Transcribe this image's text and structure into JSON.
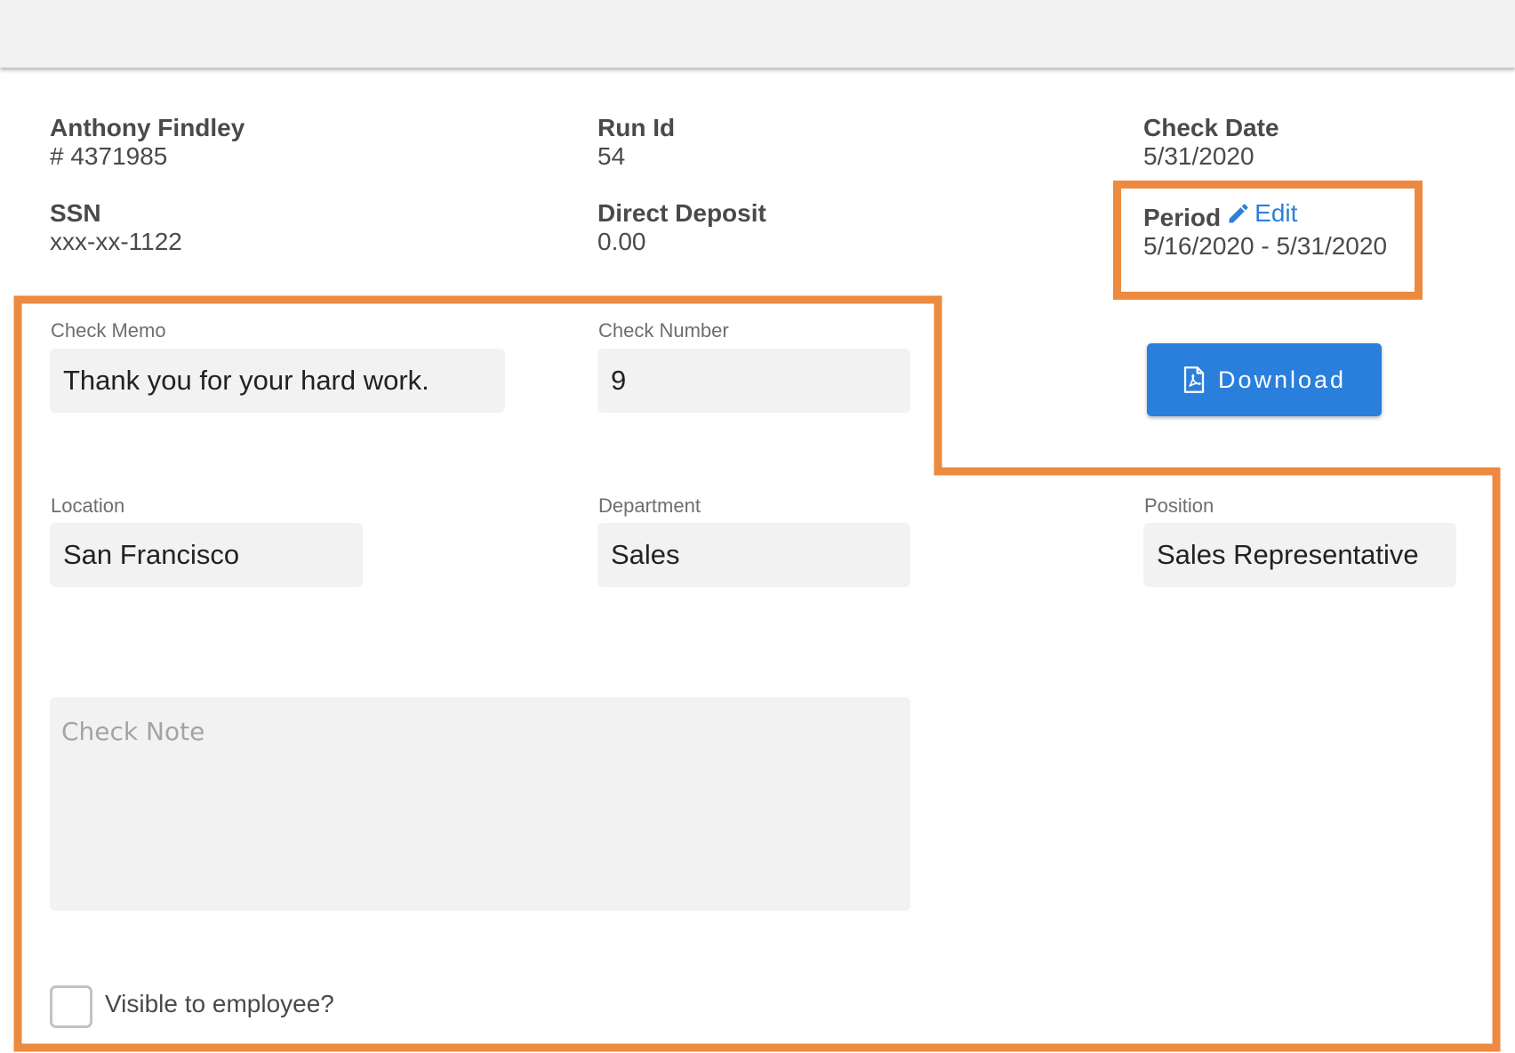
{
  "employee": {
    "name": "Anthony Findley",
    "number": "# 4371985",
    "ssn_label": "SSN",
    "ssn_value": "xxx-xx-1122"
  },
  "run": {
    "run_id_label": "Run Id",
    "run_id_value": "54",
    "direct_deposit_label": "Direct Deposit",
    "direct_deposit_value": "0.00"
  },
  "check": {
    "check_date_label": "Check Date",
    "check_date_value": "5/31/2020",
    "period_label": "Period",
    "period_edit_label": "Edit",
    "period_value": "5/16/2020 - 5/31/2020"
  },
  "download_button": {
    "label": "Download",
    "icon": "pdf-file-icon"
  },
  "form": {
    "check_memo": {
      "label": "Check Memo",
      "value": "Thank you for your hard work."
    },
    "check_number": {
      "label": "Check Number",
      "value": "9"
    },
    "location": {
      "label": "Location",
      "value": "San Francisco"
    },
    "department": {
      "label": "Department",
      "value": "Sales"
    },
    "position": {
      "label": "Position",
      "value": "Sales Representative"
    },
    "check_note": {
      "placeholder": "Check Note",
      "value": ""
    },
    "visible_to_employee": {
      "label": "Visible to employee?",
      "checked": false
    }
  },
  "colors": {
    "highlight": "#ec8a3f",
    "primary": "#2a7fdc",
    "link": "#2f7fd8",
    "field_bg": "#f2f2f2"
  }
}
